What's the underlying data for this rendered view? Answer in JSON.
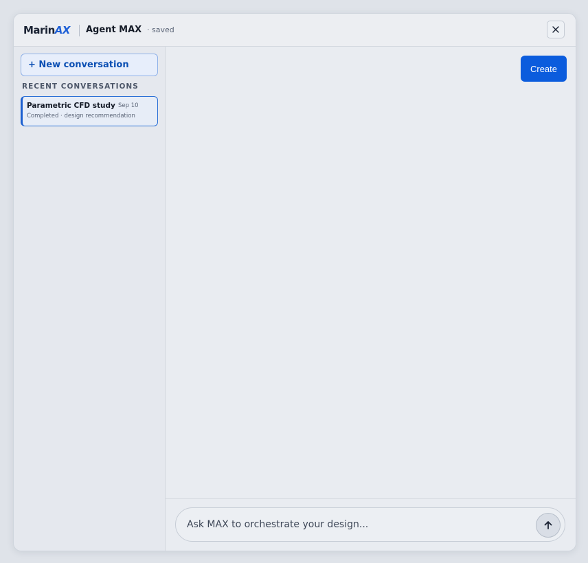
{
  "header": {
    "logo_main": "Marin",
    "logo_accent": "AX",
    "app_title": "Agent MAX",
    "save_status": "· saved",
    "close_icon": "close-icon"
  },
  "sidebar": {
    "new_conversation_label": "+ New conversation",
    "recent_heading": "RECENT CONVERSATIONS",
    "conversations": [
      {
        "title": "Parametric CFD study",
        "date": "Sep 10",
        "subtitle": "Completed · design recommendation",
        "selected": true
      }
    ]
  },
  "main": {
    "create_label": "Create"
  },
  "composer": {
    "placeholder": "Ask MAX to orchestrate your design...",
    "value": "",
    "send_icon": "arrow-up-icon"
  },
  "colors": {
    "accent": "#0b5cdd",
    "brand_accent": "#1d5fd6",
    "background": "#e9ecf1"
  }
}
